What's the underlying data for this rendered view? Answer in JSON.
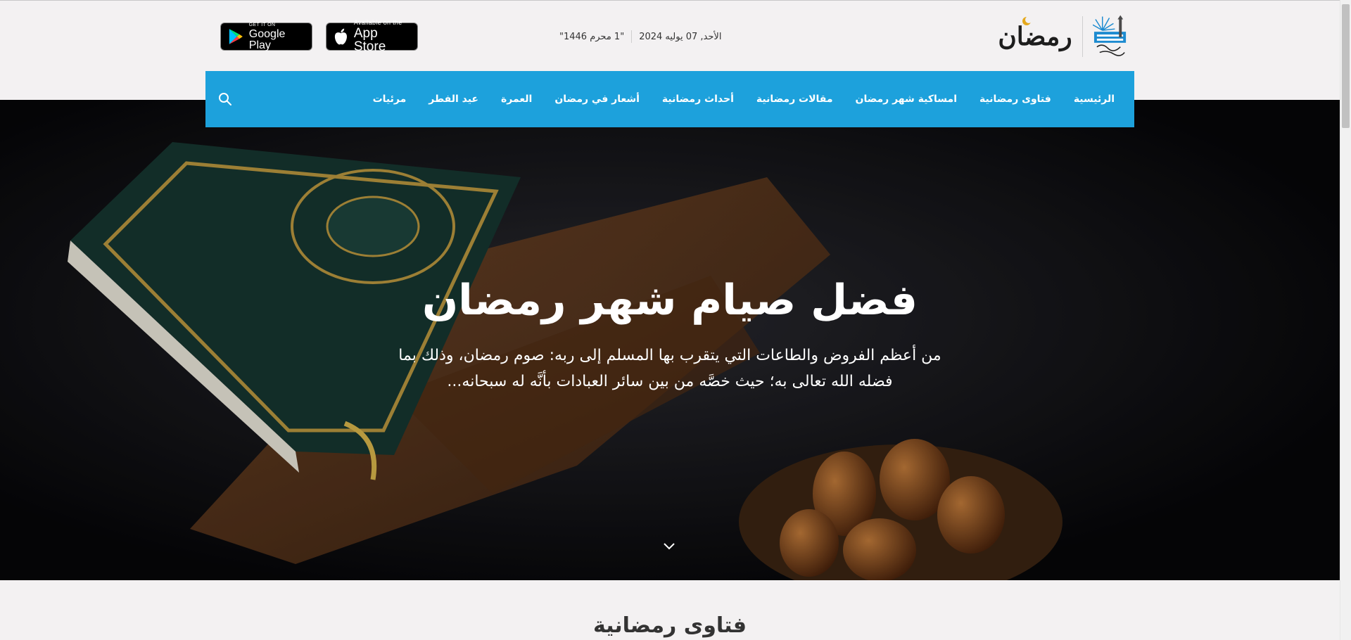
{
  "header": {
    "logo_text": "رمضان",
    "date_gregorian": "الأحد, 07 يوليه 2024",
    "date_hijri": "\"1 محرم 1446\"",
    "google_play": {
      "small": "GET IT ON",
      "big": "Google Play"
    },
    "app_store": {
      "small": "Available on the",
      "big": "App Store"
    }
  },
  "nav": {
    "items": [
      {
        "label": "الرئيسية"
      },
      {
        "label": "فتاوى رمضانية"
      },
      {
        "label": "امساكية شهر رمضان"
      },
      {
        "label": "مقالات رمضانية"
      },
      {
        "label": "أحداث رمضانية"
      },
      {
        "label": "أشعار في رمضان"
      },
      {
        "label": "العمرة"
      },
      {
        "label": "عيد الفطر"
      },
      {
        "label": "مرئيات"
      }
    ],
    "search_icon": "search-icon",
    "color": "#1da1dc"
  },
  "hero": {
    "title": "فضل صيام شهر رمضان",
    "desc_line1": "من أعظم الفروض والطاعات التي يتقرب بها المسلم إلى ربه: صوم رمضان، وذلك بما",
    "desc_line2": "فضله الله تعالى به؛ حيث خصَّه من بين سائر العبادات بأنَّه له سبحانه...",
    "scroll_icon": "chevron-down-icon"
  },
  "section": {
    "title": "فتاوى رمضانية"
  }
}
